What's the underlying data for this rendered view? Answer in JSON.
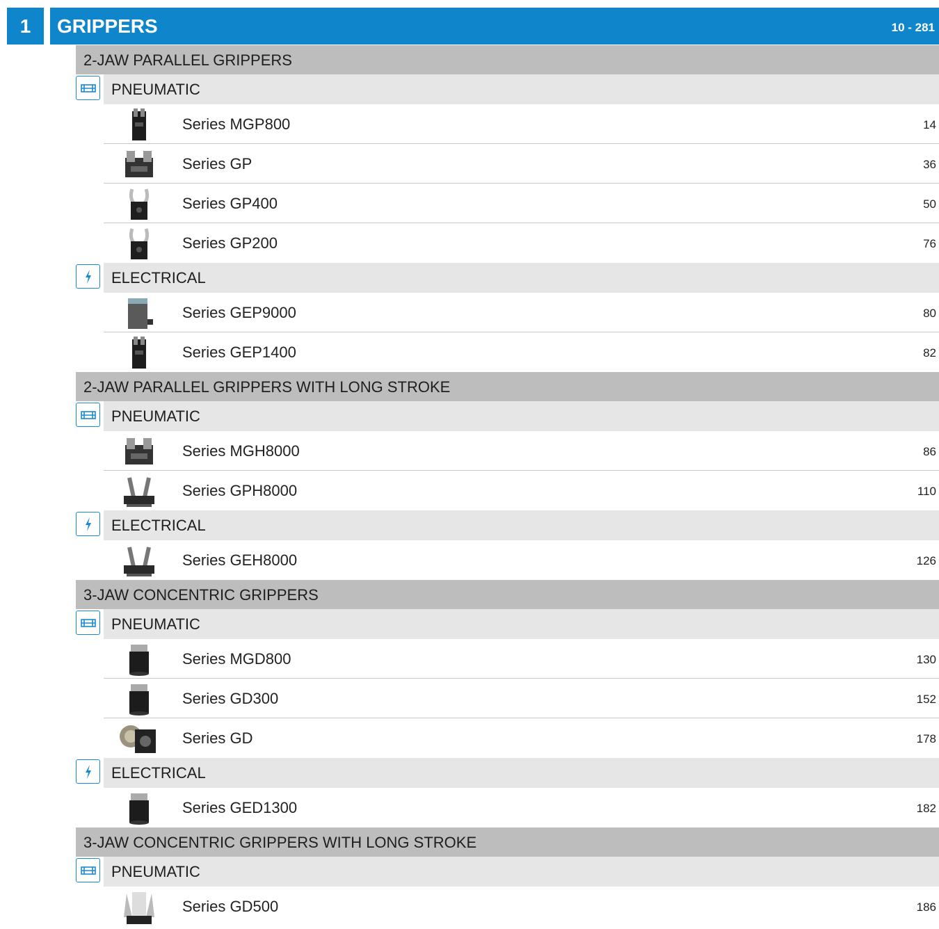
{
  "chapter": {
    "number": "1",
    "title": "GRIPPERS",
    "pages": "10 - 281"
  },
  "sections": [
    {
      "title": "2-JAW PARALLEL GRIPPERS",
      "groups": [
        {
          "type": "PNEUMATIC",
          "icon": "pneumatic-icon",
          "items": [
            {
              "name": "Series MGP800",
              "page": "14",
              "thumb": "tall"
            },
            {
              "name": "Series GP",
              "page": "36",
              "thumb": "wide"
            },
            {
              "name": "Series GP400",
              "page": "50",
              "thumb": "claw"
            },
            {
              "name": "Series GP200",
              "page": "76",
              "thumb": "claw"
            }
          ]
        },
        {
          "type": "ELECTRICAL",
          "icon": "electrical-icon",
          "items": [
            {
              "name": "Series GEP9000",
              "page": "80",
              "thumb": "box"
            },
            {
              "name": "Series GEP1400",
              "page": "82",
              "thumb": "tall"
            }
          ]
        }
      ]
    },
    {
      "title": "2-JAW PARALLEL GRIPPERS WITH LONG STROKE",
      "groups": [
        {
          "type": "PNEUMATIC",
          "icon": "pneumatic-icon",
          "items": [
            {
              "name": "Series MGH8000",
              "page": "86",
              "thumb": "wide"
            },
            {
              "name": "Series GPH8000",
              "page": "110",
              "thumb": "fork"
            }
          ]
        },
        {
          "type": "ELECTRICAL",
          "icon": "electrical-icon",
          "items": [
            {
              "name": "Series GEH8000",
              "page": "126",
              "thumb": "fork"
            }
          ]
        }
      ]
    },
    {
      "title": "3-JAW CONCENTRIC GRIPPERS",
      "groups": [
        {
          "type": "PNEUMATIC",
          "icon": "pneumatic-icon",
          "items": [
            {
              "name": "Series MGD800",
              "page": "130",
              "thumb": "cylinder"
            },
            {
              "name": "Series GD300",
              "page": "152",
              "thumb": "cylinder"
            },
            {
              "name": "Series GD",
              "page": "178",
              "thumb": "round"
            }
          ]
        },
        {
          "type": "ELECTRICAL",
          "icon": "electrical-icon",
          "items": [
            {
              "name": "Series GED1300",
              "page": "182",
              "thumb": "cylinder"
            }
          ]
        }
      ]
    },
    {
      "title": "3-JAW CONCENTRIC GRIPPERS WITH LONG STROKE",
      "groups": [
        {
          "type": "PNEUMATIC",
          "icon": "pneumatic-icon",
          "items": [
            {
              "name": "Series GD500",
              "page": "186",
              "thumb": "fan"
            }
          ]
        }
      ]
    }
  ],
  "colors": {
    "accent": "#0f86cc",
    "section_bg": "#bdbdbd",
    "subsection_bg": "#e6e6e6"
  }
}
